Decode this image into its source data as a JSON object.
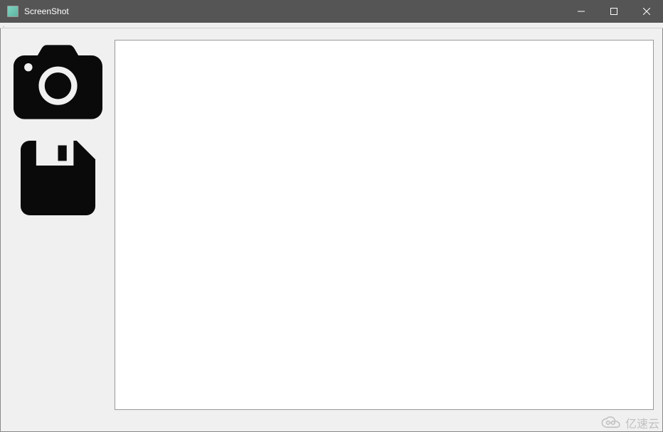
{
  "window": {
    "title": "ScreenShot"
  },
  "tools": {
    "capture_name": "camera-icon",
    "save_name": "save-icon"
  },
  "watermark": {
    "text": "亿速云"
  }
}
